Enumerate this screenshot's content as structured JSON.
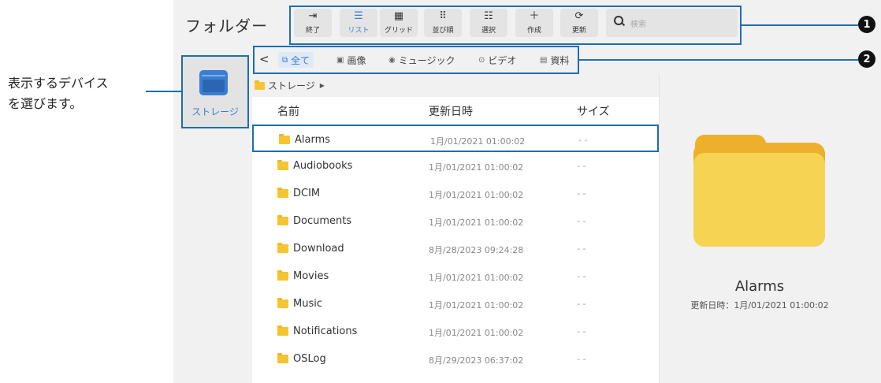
{
  "header": {
    "title": "フォルダー"
  },
  "toolbar": {
    "buttons": [
      {
        "icon": "exit-icon",
        "label": "終了"
      },
      {
        "icon": "list-icon",
        "label": "リスト"
      },
      {
        "icon": "grid-icon",
        "label": "グリッド"
      },
      {
        "icon": "sort-icon",
        "label": "並び順"
      },
      {
        "icon": "select-icon",
        "label": "選択"
      },
      {
        "icon": "create-icon",
        "label": "作成"
      },
      {
        "icon": "refresh-icon",
        "label": "更新"
      }
    ],
    "search": {
      "placeholder": "検索"
    }
  },
  "callouts": {
    "one": "1",
    "two": "2"
  },
  "filters": {
    "tabs": [
      {
        "icon": "all-icon",
        "label": "全て"
      },
      {
        "icon": "image-icon",
        "label": "画像"
      },
      {
        "icon": "music-icon",
        "label": "ミュージック"
      },
      {
        "icon": "video-icon",
        "label": "ビデオ"
      },
      {
        "icon": "document-icon",
        "label": "資料"
      }
    ]
  },
  "device": {
    "label": "ストレージ"
  },
  "annotation": {
    "line1": "表示するデバイス",
    "line2": "を選びます。"
  },
  "breadcrumb": {
    "label": "ストレージ"
  },
  "table": {
    "headers": {
      "name": "名前",
      "date": "更新日時",
      "size": "サイズ"
    },
    "rows": [
      {
        "name": "Alarms",
        "date": "1月/01/2021 01:00:02",
        "size": "- -"
      },
      {
        "name": "Audiobooks",
        "date": "1月/01/2021 01:00:02",
        "size": "- -"
      },
      {
        "name": "DCIM",
        "date": "1月/01/2021 01:00:02",
        "size": "- -"
      },
      {
        "name": "Documents",
        "date": "1月/01/2021 01:00:02",
        "size": "- -"
      },
      {
        "name": "Download",
        "date": "8月/28/2023 09:24:28",
        "size": "- -"
      },
      {
        "name": "Movies",
        "date": "1月/01/2021 01:00:02",
        "size": "- -"
      },
      {
        "name": "Music",
        "date": "1月/01/2021 01:00:02",
        "size": "- -"
      },
      {
        "name": "Notifications",
        "date": "1月/01/2021 01:00:02",
        "size": "- -"
      },
      {
        "name": "OSLog",
        "date": "8月/29/2023 06:37:02",
        "size": "- -"
      }
    ]
  },
  "preview": {
    "name": "Alarms",
    "meta": "更新日時：1月/01/2021 01:00:02"
  },
  "colors": {
    "accent": "#3a7dd3",
    "callout_border": "#1f6db1",
    "folder": "#f6d353"
  }
}
